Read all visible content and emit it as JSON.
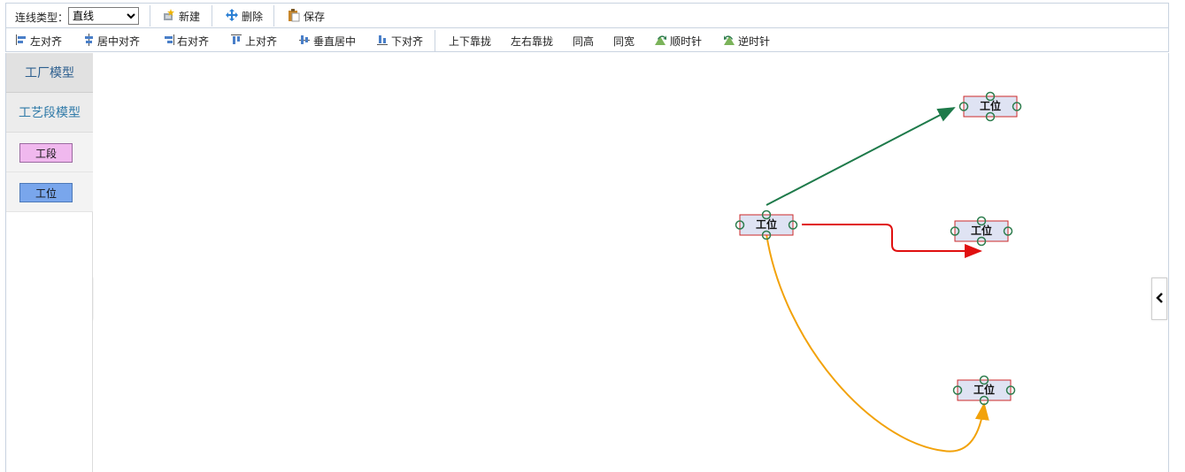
{
  "toolbar": {
    "line_type_label": "连线类型：",
    "line_type_selected": "直线",
    "new_label": "新建",
    "delete_label": "删除",
    "save_label": "保存"
  },
  "align_toolbar": {
    "align_left": "左对齐",
    "align_center": "居中对齐",
    "align_right": "右对齐",
    "align_top": "上对齐",
    "align_middle": "垂直居中",
    "align_bottom": "下对齐",
    "stack_vertical": "上下靠拢",
    "stack_horizontal": "左右靠拢",
    "same_height": "同高",
    "same_width": "同宽",
    "rotate_cw": "顺时针",
    "rotate_ccw": "逆时针"
  },
  "sidebar": {
    "factory_model": "工厂模型",
    "process_model": "工艺段模型",
    "segment_chip": "工段",
    "station_chip": "工位"
  },
  "diagram": {
    "nodes": [
      {
        "id": "n1",
        "label": "工位"
      },
      {
        "id": "n2",
        "label": "工位"
      },
      {
        "id": "n3",
        "label": "工位"
      },
      {
        "id": "n4",
        "label": "工位"
      }
    ],
    "edges": [
      {
        "from": "n1",
        "to": "n2",
        "color": "#1e7a4a",
        "style": "straight"
      },
      {
        "from": "n1",
        "to": "n3",
        "color": "#e01010",
        "style": "orthogonal"
      },
      {
        "from": "n1",
        "to": "n4",
        "color": "#f2a20a",
        "style": "curve"
      }
    ],
    "node_fill": "#dfe3f3",
    "node_border": "#cc2a2a",
    "anchor_color": "#2e7d4e"
  }
}
